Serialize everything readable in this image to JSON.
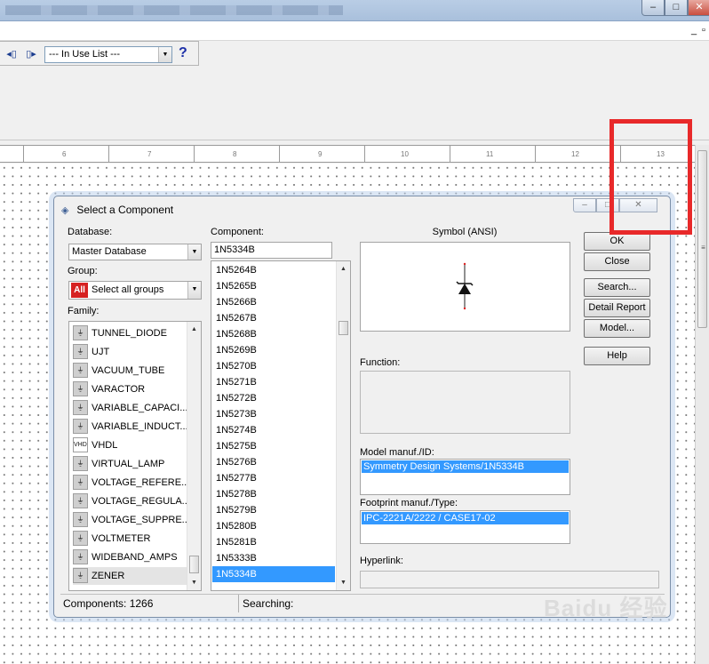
{
  "toolbar": {
    "inuse_select_value": "--- In Use List ---",
    "help_label": "?"
  },
  "ruler": {
    "ticks": [
      "6",
      "7",
      "8",
      "9",
      "10",
      "11",
      "12",
      "13"
    ]
  },
  "dialog": {
    "title": "Select a Component",
    "database_label": "Database:",
    "database_value": "Master Database",
    "group_label": "Group:",
    "group_badge": "All",
    "group_value": "Select all groups",
    "family_label": "Family:",
    "family_items": [
      {
        "label": "TUNNEL_DIODE",
        "icon": "tunnel-diode-icon"
      },
      {
        "label": "UJT",
        "icon": "ujt-icon"
      },
      {
        "label": "VACUUM_TUBE",
        "icon": "vacuum-tube-icon"
      },
      {
        "label": "VARACTOR",
        "icon": "varactor-icon"
      },
      {
        "label": "VARIABLE_CAPACI...",
        "icon": "variable-capacitor-icon"
      },
      {
        "label": "VARIABLE_INDUCT...",
        "icon": "variable-inductor-icon"
      },
      {
        "label": "VHDL",
        "icon": "vhdl-icon",
        "glyph": "VHDL"
      },
      {
        "label": "VIRTUAL_LAMP",
        "icon": "virtual-lamp-icon"
      },
      {
        "label": "VOLTAGE_REFERE...",
        "icon": "voltage-reference-icon"
      },
      {
        "label": "VOLTAGE_REGULA...",
        "icon": "voltage-regulator-icon"
      },
      {
        "label": "VOLTAGE_SUPPRE...",
        "icon": "voltage-suppressor-icon"
      },
      {
        "label": "VOLTMETER",
        "icon": "voltmeter-icon"
      },
      {
        "label": "WIDEBAND_AMPS",
        "icon": "wideband-amps-icon"
      },
      {
        "label": "ZENER",
        "icon": "zener-icon"
      }
    ],
    "family_selected_index": 13,
    "component_label": "Component:",
    "component_value": "1N5334B",
    "component_items": [
      "1N5264B",
      "1N5265B",
      "1N5266B",
      "1N5267B",
      "1N5268B",
      "1N5269B",
      "1N5270B",
      "1N5271B",
      "1N5272B",
      "1N5273B",
      "1N5274B",
      "1N5275B",
      "1N5276B",
      "1N5277B",
      "1N5278B",
      "1N5279B",
      "1N5280B",
      "1N5281B",
      "1N5333B",
      "1N5334B"
    ],
    "component_selected_index": 19,
    "symbol_label": "Symbol (ANSI)",
    "function_label": "Function:",
    "model_label": "Model manuf./ID:",
    "model_value": "Symmetry Design Systems/1N5334B",
    "footprint_label": "Footprint manuf./Type:",
    "footprint_value": "IPC-2221A/2222 / CASE17-02",
    "hyperlink_label": "Hyperlink:",
    "buttons": {
      "ok": "OK",
      "close": "Close",
      "search": "Search...",
      "detail_report": "Detail Report",
      "model": "Model...",
      "help": "Help"
    },
    "status_components": "Components: 1266",
    "status_searching": "Searching:"
  },
  "watermark": "Baidu 经验",
  "colors": {
    "selection": "#3399ff",
    "annotation": "#e8292a",
    "group_badge": "#d62121"
  }
}
